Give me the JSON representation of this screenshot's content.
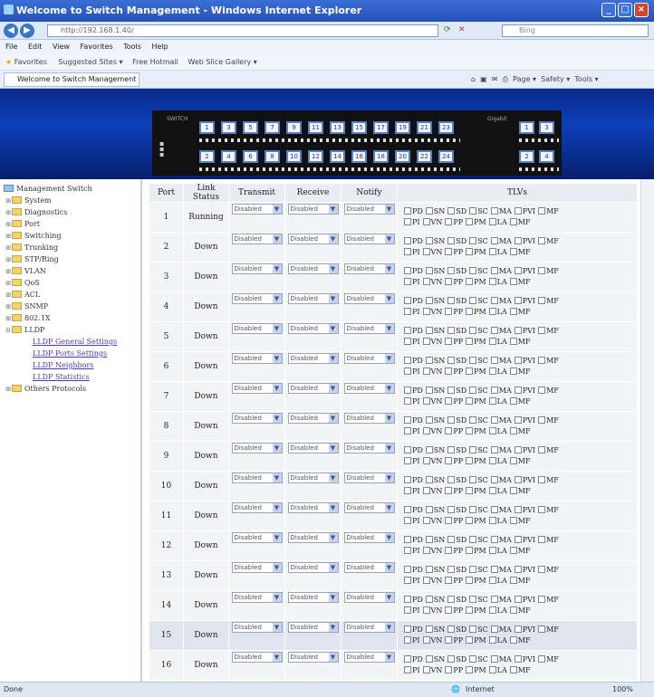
{
  "window": {
    "title": "Welcome to Switch Management - Windows Internet Explorer"
  },
  "addressbar": {
    "url": "http://192.168.1.40/"
  },
  "menu": [
    "File",
    "Edit",
    "View",
    "Favorites",
    "Tools",
    "Help"
  ],
  "favorites": {
    "label": "Favorites",
    "items": [
      "Suggested Sites ▾",
      "Free Hotmail",
      "Web Slice Gallery ▾"
    ]
  },
  "tab": {
    "title": "Welcome to Switch Management"
  },
  "toolbar": {
    "page": "Page ▾",
    "safety": "Safety ▾",
    "tools": "Tools ▾"
  },
  "switch": {
    "label_left": "SWITCH",
    "label_right": "Gigabit",
    "top_ports": [
      "1",
      "3",
      "5",
      "7",
      "9",
      "11",
      "13",
      "15",
      "17",
      "19",
      "21",
      "23"
    ],
    "bottom_ports": [
      "2",
      "4",
      "6",
      "8",
      "10",
      "12",
      "14",
      "16",
      "18",
      "20",
      "22",
      "24"
    ],
    "gig_top": [
      "1",
      "3"
    ],
    "gig_bottom": [
      "2",
      "4"
    ]
  },
  "sidebar": {
    "root": "Management Switch",
    "items": [
      "System",
      "Diagnostics",
      "Port",
      "Switching",
      "Trunking",
      "STP/Ring",
      "VLAN",
      "QoS",
      "ACL",
      "SNMP",
      "802.1X",
      "LLDP"
    ],
    "lldp_sub": [
      "LLDP General Settings",
      "LLDP Ports Settings",
      "LLDP Neighbors",
      "LLDP Statistics"
    ],
    "after": [
      "Others Protocols"
    ]
  },
  "table": {
    "headers": [
      "Port",
      "Link Status",
      "Transmit",
      "Receive",
      "Notify",
      "TLVs"
    ],
    "select_value": "Disabled",
    "tlv_row1": [
      "PD",
      "SN",
      "SD",
      "SC",
      "MA",
      "PVI",
      "MF"
    ],
    "tlv_row2": [
      "PI",
      "VN",
      "PP",
      "PM",
      "LA",
      "MF"
    ],
    "rows": [
      {
        "port": "1",
        "status": "Running"
      },
      {
        "port": "2",
        "status": "Down"
      },
      {
        "port": "3",
        "status": "Down"
      },
      {
        "port": "4",
        "status": "Down"
      },
      {
        "port": "5",
        "status": "Down"
      },
      {
        "port": "6",
        "status": "Down"
      },
      {
        "port": "7",
        "status": "Down"
      },
      {
        "port": "8",
        "status": "Down"
      },
      {
        "port": "9",
        "status": "Down"
      },
      {
        "port": "10",
        "status": "Down"
      },
      {
        "port": "11",
        "status": "Down"
      },
      {
        "port": "12",
        "status": "Down"
      },
      {
        "port": "13",
        "status": "Down"
      },
      {
        "port": "14",
        "status": "Down"
      },
      {
        "port": "15",
        "status": "Down"
      },
      {
        "port": "16",
        "status": "Down"
      }
    ]
  },
  "statusbar": {
    "left": "Done",
    "zone": "Internet",
    "zoom": "100%"
  }
}
